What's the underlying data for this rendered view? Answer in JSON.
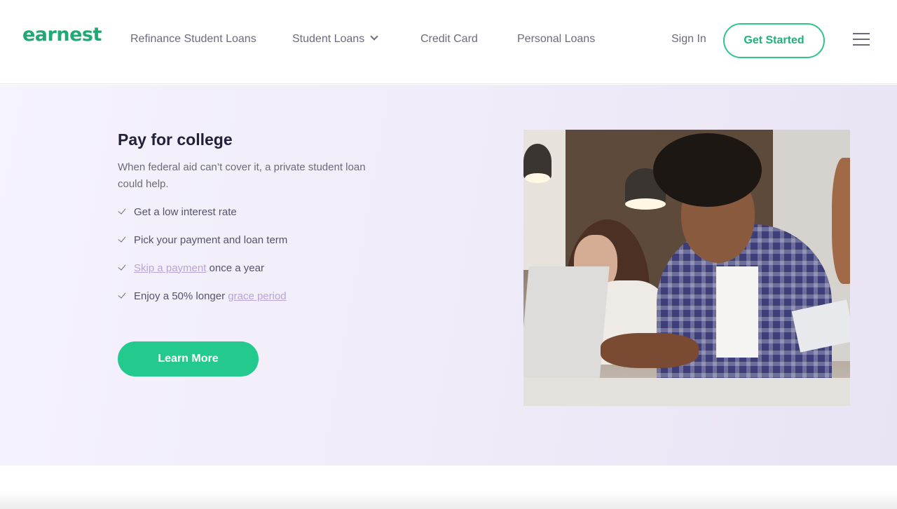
{
  "header": {
    "logo": "earnest",
    "nav": [
      {
        "label": "Refinance Student Loans"
      },
      {
        "label": "Student Loans",
        "has_dropdown": true
      },
      {
        "label": "Credit Card"
      },
      {
        "label": "Personal Loans"
      }
    ],
    "sign_in": "Sign In",
    "get_started": "Get Started",
    "menu_icon": "hamburger-menu-icon"
  },
  "hero": {
    "title": "Pay for college",
    "subtitle": "When federal aid can’t cover it, a private student loan could help.",
    "features": [
      {
        "text": "Get a low interest rate"
      },
      {
        "text": "Pick your payment and loan term"
      },
      {
        "link": "Skip a payment",
        "text": " once a year"
      },
      {
        "text": "Enjoy a 50% longer ",
        "link": "grace period"
      }
    ],
    "cta": "Learn More",
    "image_alt": "Student with earbuds typing on a laptop in a cafe"
  },
  "colors": {
    "brand_green": "#24c98d",
    "text_dark": "#22203a",
    "text_muted": "#6d6a7c",
    "link_lavender": "#b9a3d9",
    "hero_bg": "#efebf8"
  }
}
